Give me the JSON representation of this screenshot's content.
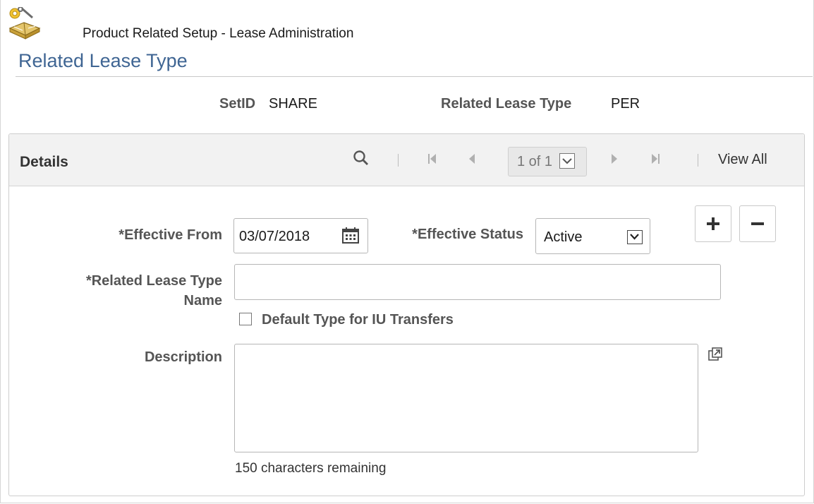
{
  "breadcrumb": "Product Related Setup - Lease Administration",
  "page_title": "Related Lease Type",
  "header": {
    "setid_label": "SetID",
    "setid_value": "SHARE",
    "type_label": "Related Lease Type",
    "type_value": "PER"
  },
  "details": {
    "title": "Details",
    "pager_text": "1 of 1",
    "view_all": "View All"
  },
  "form": {
    "effective_from_label": "*Effective From",
    "effective_from_value": "03/07/2018",
    "effective_status_label": "*Effective Status",
    "effective_status_value": "Active",
    "name_label_line1": "*Related Lease Type",
    "name_label_line2": "Name",
    "name_value": "",
    "default_type_label": "Default Type for IU Transfers",
    "default_type_checked": false,
    "description_label": "Description",
    "description_value": "",
    "chars_remaining": "150 characters remaining"
  },
  "colors": {
    "title": "#3f6593",
    "label": "#555555",
    "header_bg": "#f2f2f2"
  },
  "icons": [
    "book-wrench-icon",
    "search-icon",
    "first-page-icon",
    "prev-page-icon",
    "chevron-down-icon",
    "next-page-icon",
    "last-page-icon",
    "calendar-icon",
    "add-row-icon",
    "delete-row-icon",
    "expand-popup-icon"
  ]
}
